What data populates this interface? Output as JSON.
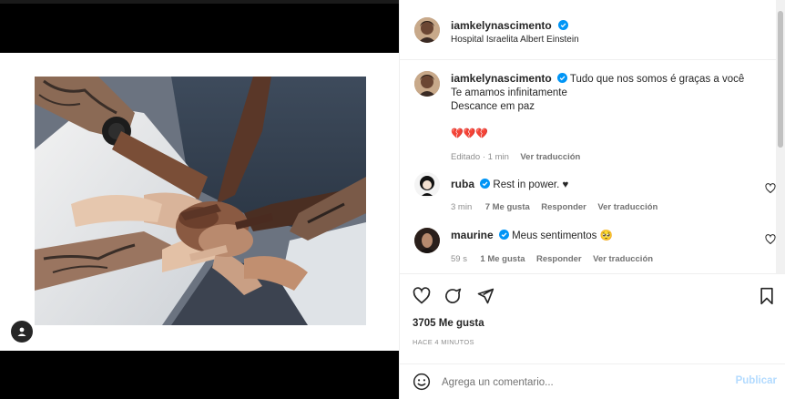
{
  "post": {
    "username": "iamkelynascimento",
    "location": "Hospital Israelita Albert Einstein"
  },
  "caption": {
    "username": "iamkelynascimento",
    "line1": "Tudo que nos somos é graças a você",
    "line2": "Te amamos infinitamente",
    "line3": "Descance em paz",
    "emojis": "💔💔💔",
    "edited": "Editado · 1 min",
    "translate": "Ver traducción"
  },
  "comments": [
    {
      "username": "ruba",
      "text": "Rest in power. ♥",
      "time": "3 min",
      "likes": "7 Me gusta",
      "reply": "Responder",
      "translate": "Ver traducción"
    },
    {
      "username": "maurine",
      "text": "Meus sentimentos 🥺",
      "time": "59 s",
      "likes": "1 Me gusta",
      "reply": "Responder",
      "translate": "Ver traducción"
    }
  ],
  "stats": {
    "likes": "3705 Me gusta",
    "time_ago": "HACE 4 MINUTOS"
  },
  "composer": {
    "placeholder": "Agrega un comentario...",
    "publish": "Publicar"
  },
  "colors": {
    "verified": "#0095f6",
    "publish_disabled": "#b3dbff",
    "muted": "#8e8e8e"
  }
}
